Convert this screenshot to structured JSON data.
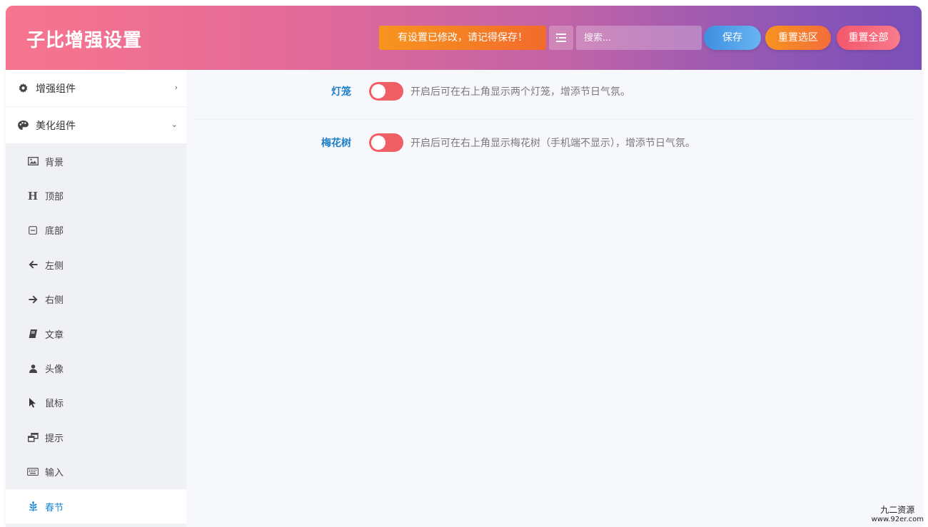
{
  "header": {
    "title": "子比增强设置",
    "notice": "有设置已修改，请记得保存！",
    "search_placeholder": "搜索...",
    "save_label": "保存",
    "reset_section_label": "重置选区",
    "reset_all_label": "重置全部"
  },
  "sidebar": {
    "groups": [
      {
        "label": "增强组件",
        "icon": "gear-icon",
        "chevron": "›"
      },
      {
        "label": "美化组件",
        "icon": "palette-icon",
        "chevron": "⌄"
      }
    ],
    "items": [
      {
        "label": "背景",
        "icon": "image-icon"
      },
      {
        "label": "顶部",
        "icon": "heading-icon"
      },
      {
        "label": "底部",
        "icon": "square-minus-icon"
      },
      {
        "label": "左侧",
        "icon": "arrow-left-icon"
      },
      {
        "label": "右侧",
        "icon": "arrow-right-icon"
      },
      {
        "label": "文章",
        "icon": "book-icon"
      },
      {
        "label": "头像",
        "icon": "user-icon"
      },
      {
        "label": "鼠标",
        "icon": "cursor-icon"
      },
      {
        "label": "提示",
        "icon": "windows-icon"
      },
      {
        "label": "输入",
        "icon": "keyboard-icon"
      },
      {
        "label": "春节",
        "icon": "wheat-icon",
        "active": true
      }
    ]
  },
  "settings": [
    {
      "label": "灯笼",
      "enabled": false,
      "description": "开启后可在右上角显示两个灯笼，增添节日气氛。"
    },
    {
      "label": "梅花树",
      "enabled": false,
      "description": "开启后可在右上角显示梅花树（手机端不显示），增添节日气氛。"
    }
  ],
  "watermark": {
    "line1": "九二资源",
    "line2": "www.92er.com"
  },
  "colors": {
    "accent": "#1e88d6",
    "toggle_off": "#f05e66",
    "notice": "#f7941e"
  }
}
